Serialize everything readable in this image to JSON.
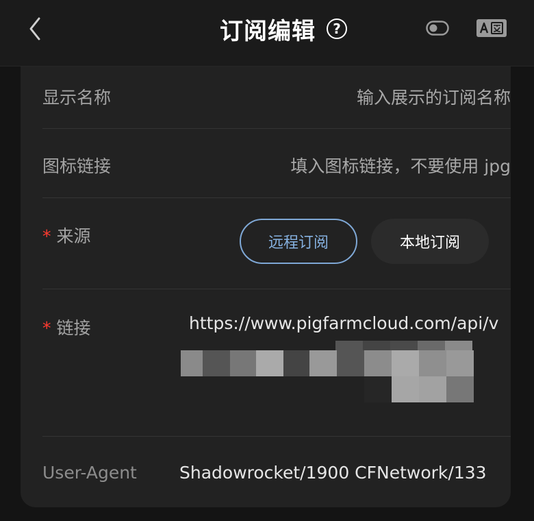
{
  "header": {
    "title": "订阅编辑",
    "help_label": "?",
    "icons": {
      "back": "chevron-left-icon",
      "help": "question-circle-icon",
      "toggle": "toggle-icon",
      "translate": "translate-icon"
    }
  },
  "form": {
    "display_name": {
      "label": "显示名称",
      "placeholder": "输入展示的订阅名称"
    },
    "icon_link": {
      "label": "图标链接",
      "placeholder": "填入图标链接，不要使用 jpg"
    },
    "source": {
      "required_mark": "*",
      "label": "来源",
      "options": [
        "远程订阅",
        "本地订阅"
      ]
    },
    "link": {
      "required_mark": "*",
      "label": "链接",
      "value": "https://www.pigfarmcloud.com/api/v"
    },
    "user_agent": {
      "label": "User-Agent",
      "value": "Shadowrocket/1900 CFNetwork/133"
    }
  },
  "colors": {
    "background": "#141414",
    "card": "#222222",
    "accent_blue": "#7fa8d6",
    "required_red": "#ff3b30"
  }
}
